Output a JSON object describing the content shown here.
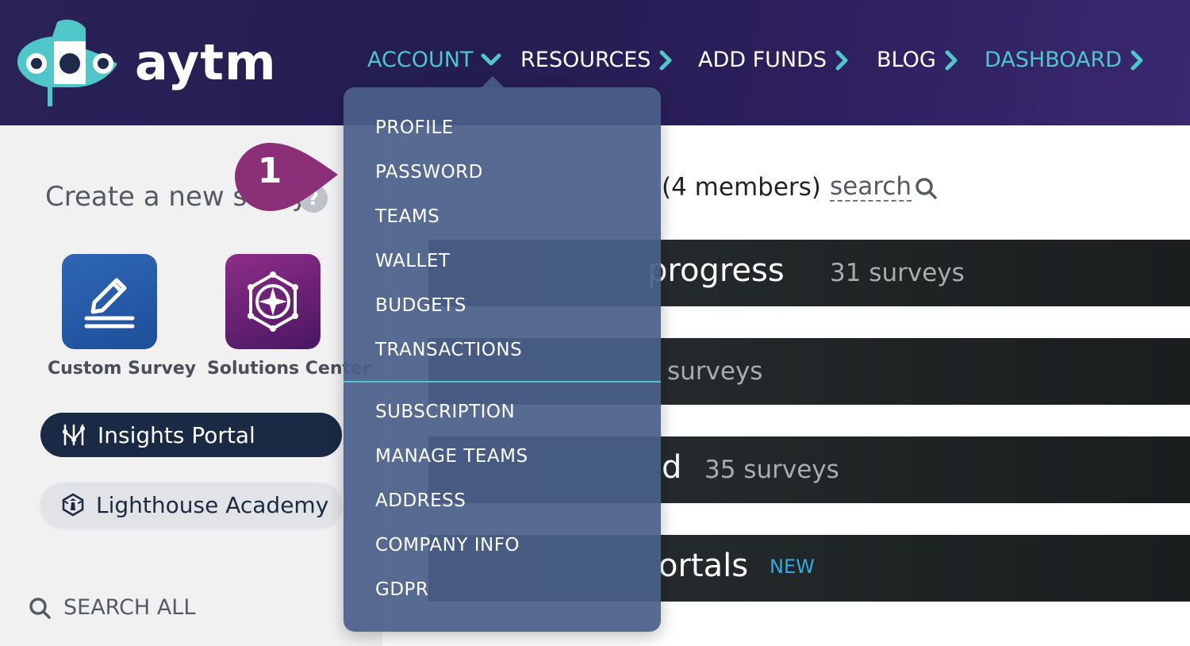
{
  "brand": {
    "name": "aytm"
  },
  "nav": {
    "account": "ACCOUNT",
    "resources": "RESOURCES",
    "add_funds": "ADD FUNDS",
    "blog": "BLOG",
    "dashboard": "DASHBOARD"
  },
  "dropdown": {
    "group1": [
      "PROFILE",
      "PASSWORD",
      "TEAMS",
      "WALLET",
      "BUDGETS",
      "TRANSACTIONS"
    ],
    "group2": [
      "SUBSCRIPTION",
      "MANAGE TEAMS",
      "ADDRESS",
      "COMPANY INFO",
      "GDPR"
    ]
  },
  "sidebar": {
    "create_title": "Create a new study",
    "help": "?",
    "tiles": {
      "custom_survey": "Custom Survey",
      "solutions_center": "Solutions Center"
    },
    "insights_portal": "Insights Portal",
    "lighthouse_academy": "Lighthouse Academy",
    "search_all": "SEARCH ALL"
  },
  "main": {
    "team_members": "(4 members)",
    "search": "search",
    "bands": [
      {
        "title": "progress",
        "count": "31 surveys"
      },
      {
        "title": "",
        "count": "surveys"
      },
      {
        "title": "d",
        "count": "35 surveys"
      },
      {
        "title": "ortals",
        "badge": "NEW"
      }
    ]
  },
  "annotation": {
    "step": "1"
  },
  "colors": {
    "header": "#241d52",
    "teal": "#4fc7c8",
    "dropdown_bg": "#4a608a",
    "insights_pill": "#1a2a44",
    "band": "#1f2425",
    "badge": "#8a2f78",
    "new_badge": "#3aa8e0"
  }
}
